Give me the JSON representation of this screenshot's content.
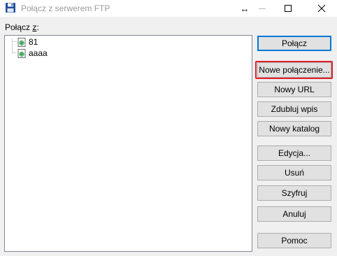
{
  "window": {
    "title": "Połącz z serwerem FTP",
    "icon": "floppy-disk-icon"
  },
  "title_buttons": {
    "resize": "↔",
    "minimize": "minimize-icon",
    "maximize": "maximize-icon",
    "close": "close-icon"
  },
  "connect_label": {
    "prefix": "Połącz ",
    "accel": "z",
    "suffix": ":"
  },
  "tree": {
    "items": [
      {
        "label": "81",
        "icon": "server-globe-icon"
      },
      {
        "label": "aaaa",
        "icon": "server-globe-icon"
      }
    ]
  },
  "buttons": {
    "connect": "Połącz",
    "new_connection": "Nowe połączenie...",
    "new_url": "Nowy URL",
    "duplicate": "Zdubluj wpis",
    "new_folder": "Nowy katalog",
    "edit": "Edycja...",
    "delete": "Usuń",
    "encrypt": "Szyfruj",
    "cancel": "Anuluj",
    "help": "Pomoc"
  },
  "colors": {
    "highlight": "#e0202a",
    "default_border": "#0078d7",
    "title_text": "#9a9a9a"
  }
}
